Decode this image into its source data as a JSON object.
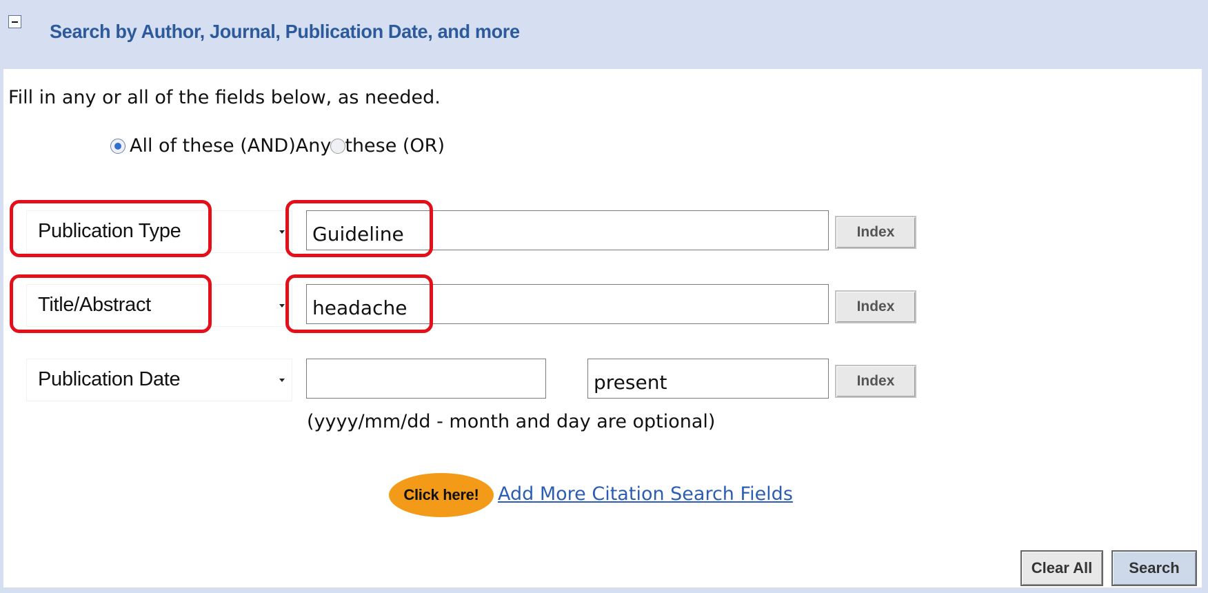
{
  "header": {
    "title": "Search by Author, Journal, Publication Date, and more",
    "collapse_icon": "minus-box-icon"
  },
  "instructions": "Fill in any or all of the fields below, as needed.",
  "logic": {
    "options": [
      {
        "label": "All of these (AND)",
        "checked": true
      },
      {
        "label_pre": "Any ",
        "label_post": "these (OR)",
        "checked": false
      }
    ]
  },
  "rows": [
    {
      "field": "Publication Type",
      "value": "Guideline",
      "index_label": "Index",
      "highlighted": true
    },
    {
      "field": "Title/Abstract",
      "value": "headache",
      "index_label": "Index",
      "highlighted": true
    },
    {
      "field": "Publication Date",
      "from_value": "",
      "to_value": "present",
      "index_label": "Index",
      "hint": "(yyyy/mm/dd - month and day are optional)"
    }
  ],
  "more_fields": {
    "badge_label": "Click here!",
    "link_label": "Add More Citation Search Fields"
  },
  "actions": {
    "clear_label": "Clear All",
    "search_label": "Search"
  },
  "colors": {
    "panel_background": "#d6dff2",
    "header_title": "#2c5a9a",
    "highlight": "#e3101a",
    "link": "#2c5db5",
    "badge": "#f49a19"
  }
}
